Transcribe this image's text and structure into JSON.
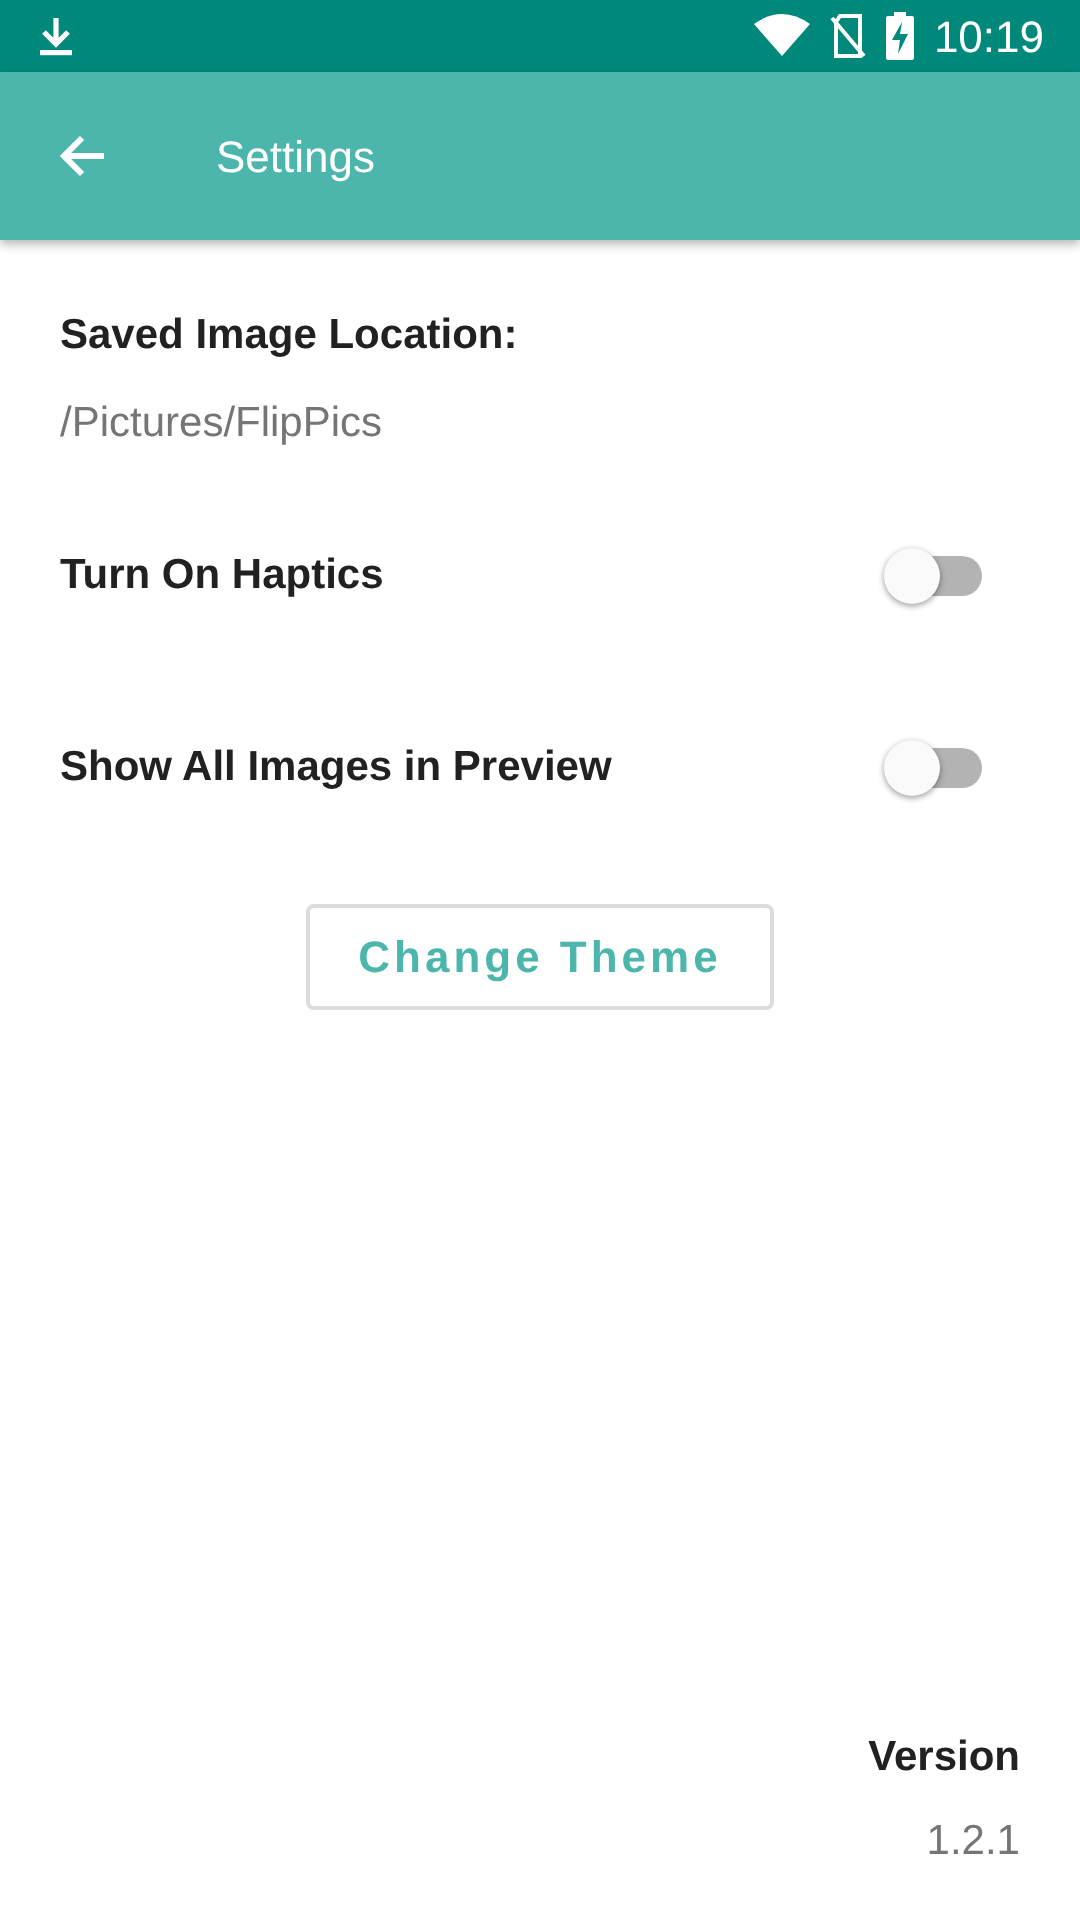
{
  "status_bar": {
    "time": "10:19"
  },
  "app_bar": {
    "title": "Settings"
  },
  "saved_location": {
    "label": "Saved Image Location:",
    "value": "/Pictures/FlipPics"
  },
  "toggles": [
    {
      "label": "Turn On Haptics",
      "on": false
    },
    {
      "label": "Show All Images in Preview",
      "on": false
    }
  ],
  "change_theme_button": "Change Theme",
  "version": {
    "label": "Version",
    "value": "1.2.1"
  }
}
